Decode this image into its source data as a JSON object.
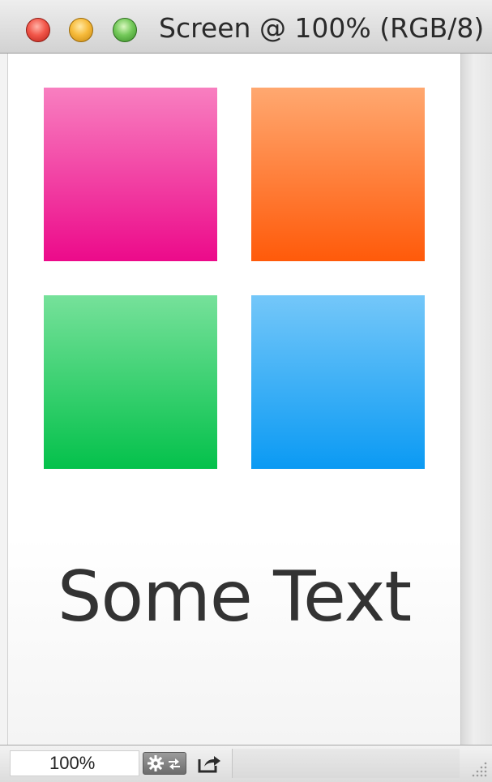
{
  "window": {
    "title": "Screen @ 100% (RGB/8)"
  },
  "canvas": {
    "text": "Some Text",
    "swatches": [
      {
        "name": "pink",
        "color_top": "#f87fc0",
        "color_bottom": "#ec0a8a"
      },
      {
        "name": "orange",
        "color_top": "#ffa870",
        "color_bottom": "#ff5a0a"
      },
      {
        "name": "green",
        "color_top": "#76e19a",
        "color_bottom": "#04c14b"
      },
      {
        "name": "blue",
        "color_top": "#74c7f9",
        "color_bottom": "#0b9af3"
      }
    ]
  },
  "statusbar": {
    "zoom": "100%",
    "tools_icon": "gear-arrows-icon",
    "share_icon": "share-arrow-icon",
    "resize_icon": "resize-grip-icon"
  }
}
